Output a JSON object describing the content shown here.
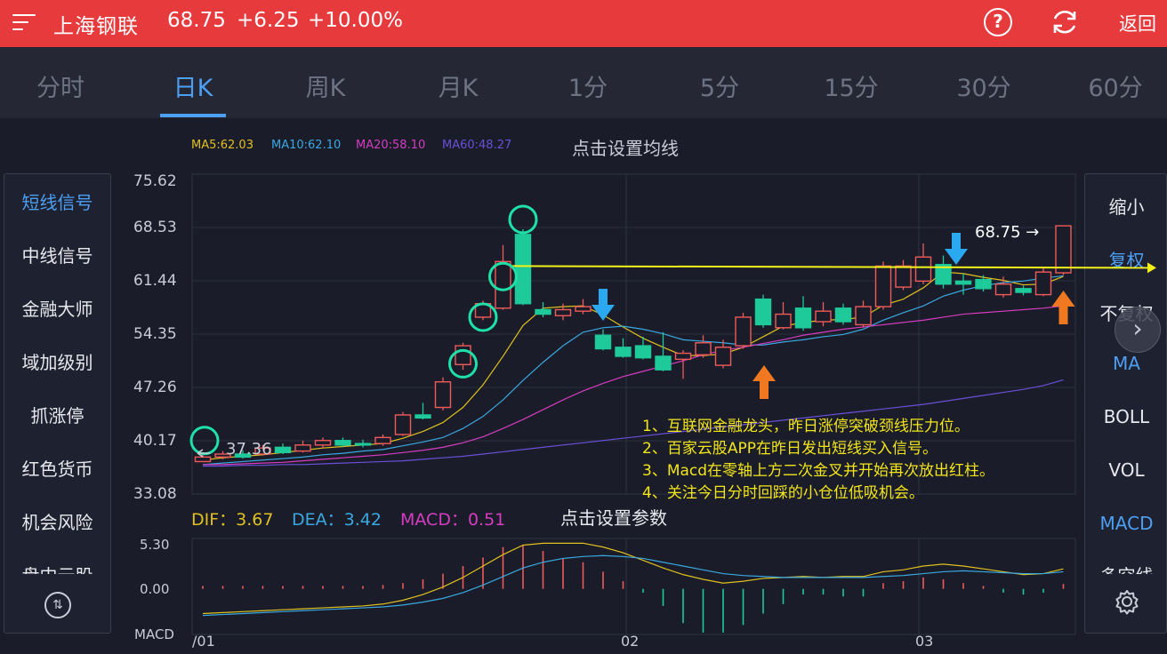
{
  "header": {
    "title": "上海钢联",
    "price": "68.75",
    "change": "+6.25",
    "change_pct": "+10.00%",
    "back_label": "返回",
    "help_label": "?"
  },
  "tabs": [
    {
      "label": "分时",
      "active": false
    },
    {
      "label": "日K",
      "active": true
    },
    {
      "label": "周K",
      "active": false
    },
    {
      "label": "月K",
      "active": false
    },
    {
      "label": "1分",
      "active": false
    },
    {
      "label": "5分",
      "active": false
    },
    {
      "label": "15分",
      "active": false
    },
    {
      "label": "30分",
      "active": false
    },
    {
      "label": "60分",
      "active": false
    }
  ],
  "ma_legend": [
    {
      "label": "MA5:62.03",
      "color": "#e0c020"
    },
    {
      "label": "MA10:62.10",
      "color": "#3aa8e0"
    },
    {
      "label": "MA20:58.10",
      "color": "#d63cc0"
    },
    {
      "label": "MA60:48.27",
      "color": "#6a4fd8"
    }
  ],
  "ma_setting_label": "点击设置均线",
  "left_panel": {
    "items": [
      {
        "label": "短线信号",
        "active": true
      },
      {
        "label": "中线信号",
        "active": false
      },
      {
        "label": "金融大师",
        "active": false
      },
      {
        "label": "域加级别",
        "active": false
      },
      {
        "label": "抓涨停",
        "active": false
      },
      {
        "label": "红色货币",
        "active": false
      },
      {
        "label": "机会风险",
        "active": false
      },
      {
        "label": "盘中云股",
        "active": false
      }
    ]
  },
  "right_panel": {
    "items": [
      {
        "label": "缩小",
        "blue": false
      },
      {
        "label": "复权",
        "blue": true
      },
      {
        "label": "不复权",
        "blue": false
      },
      {
        "label": "MA",
        "blue": true
      },
      {
        "label": "BOLL",
        "blue": false
      },
      {
        "label": "VOL",
        "blue": false
      },
      {
        "label": "MACD",
        "blue": true
      },
      {
        "label": "多空线",
        "blue": false
      }
    ]
  },
  "price_axis": [
    "75.62",
    "68.53",
    "61.44",
    "54.35",
    "47.26",
    "40.17",
    "33.08"
  ],
  "indicator": {
    "dif": "DIF：3.67",
    "dea": "DEA：3.42",
    "macd": "MACD：0.51",
    "dif_color": "#e0c020",
    "dea_color": "#3aa8e0",
    "macd_color": "#d63cc0",
    "setting_label": "点击设置参数"
  },
  "macd_axis": [
    "5.30",
    "0.00",
    "MACD"
  ],
  "date_labels": [
    "/01",
    "02",
    "03"
  ],
  "notes": [
    "1、互联网金融龙头，昨日涨停突破颈线压力位。",
    "2、百家云股APP在昨日发出短线买入信号。",
    "3、Macd在零轴上方二次金叉并开始再次放出红柱。",
    "4、关注今日分时回踩的小仓位低吸机会。"
  ],
  "marks": {
    "last_price": "68.75 →",
    "low_price": "37.36"
  },
  "colors": {
    "up": "#f05a5a",
    "down": "#1ec99a",
    "resistance_line": "#f2f21a",
    "signal_circle": "#1ee0a8",
    "sell_arrow": "#2aa8f0",
    "buy_arrow": "#f07820"
  },
  "chart_data": {
    "type": "candlestick",
    "ylim": [
      33.08,
      75.62
    ],
    "candles": [
      {
        "o": 37.4,
        "c": 38.0,
        "h": 38.3,
        "l": 37.36
      },
      {
        "o": 38.0,
        "c": 38.4,
        "h": 38.8,
        "l": 37.7
      },
      {
        "o": 38.4,
        "c": 38.0,
        "h": 38.9,
        "l": 37.8
      },
      {
        "o": 38.4,
        "c": 39.2,
        "h": 39.6,
        "l": 38.2
      },
      {
        "o": 39.3,
        "c": 38.6,
        "h": 39.8,
        "l": 38.4
      },
      {
        "o": 38.8,
        "c": 39.6,
        "h": 40.2,
        "l": 38.6
      },
      {
        "o": 39.6,
        "c": 40.2,
        "h": 40.6,
        "l": 39.2
      },
      {
        "o": 40.2,
        "c": 39.6,
        "h": 40.6,
        "l": 39.3
      },
      {
        "o": 39.8,
        "c": 39.6,
        "h": 40.3,
        "l": 39.3
      },
      {
        "o": 39.8,
        "c": 40.6,
        "h": 41.0,
        "l": 39.5
      },
      {
        "o": 41.0,
        "c": 43.6,
        "h": 44.0,
        "l": 40.8
      },
      {
        "o": 43.6,
        "c": 43.2,
        "h": 45.2,
        "l": 43.0
      },
      {
        "o": 44.6,
        "c": 48.0,
        "h": 48.6,
        "l": 44.2
      },
      {
        "o": 50.3,
        "c": 52.8,
        "h": 53.2,
        "l": 49.6
      },
      {
        "o": 56.6,
        "c": 58.4,
        "h": 58.8,
        "l": 56.2
      },
      {
        "o": 57.8,
        "c": 64.0,
        "h": 66.2,
        "l": 57.6
      },
      {
        "o": 67.6,
        "c": 58.4,
        "h": 68.3,
        "l": 58.2
      },
      {
        "o": 57.6,
        "c": 57.0,
        "h": 58.6,
        "l": 56.6
      },
      {
        "o": 56.8,
        "c": 57.6,
        "h": 58.4,
        "l": 56.2
      },
      {
        "o": 57.4,
        "c": 58.0,
        "h": 59.0,
        "l": 57.0
      },
      {
        "o": 54.2,
        "c": 52.4,
        "h": 55.0,
        "l": 52.2
      },
      {
        "o": 52.6,
        "c": 51.4,
        "h": 53.8,
        "l": 51.2
      },
      {
        "o": 52.8,
        "c": 51.2,
        "h": 54.0,
        "l": 51.0
      },
      {
        "o": 51.4,
        "c": 49.6,
        "h": 54.6,
        "l": 49.4
      },
      {
        "o": 51.0,
        "c": 51.8,
        "h": 52.2,
        "l": 48.4
      },
      {
        "o": 51.6,
        "c": 53.2,
        "h": 54.2,
        "l": 51.2
      },
      {
        "o": 50.2,
        "c": 52.6,
        "h": 53.6,
        "l": 49.8
      },
      {
        "o": 52.8,
        "c": 56.6,
        "h": 57.2,
        "l": 52.4
      },
      {
        "o": 59.0,
        "c": 55.6,
        "h": 59.6,
        "l": 55.2
      },
      {
        "o": 55.2,
        "c": 57.0,
        "h": 58.6,
        "l": 55.0
      },
      {
        "o": 57.8,
        "c": 55.2,
        "h": 59.4,
        "l": 54.8
      },
      {
        "o": 56.0,
        "c": 57.4,
        "h": 58.6,
        "l": 55.4
      },
      {
        "o": 57.8,
        "c": 56.0,
        "h": 58.4,
        "l": 55.6
      },
      {
        "o": 55.6,
        "c": 58.0,
        "h": 58.8,
        "l": 55.2
      },
      {
        "o": 58.0,
        "c": 63.4,
        "h": 64.0,
        "l": 57.6
      },
      {
        "o": 60.6,
        "c": 63.4,
        "h": 64.2,
        "l": 60.2
      },
      {
        "o": 61.4,
        "c": 64.6,
        "h": 66.4,
        "l": 61.0
      },
      {
        "o": 63.6,
        "c": 61.0,
        "h": 64.8,
        "l": 60.4
      },
      {
        "o": 61.4,
        "c": 61.0,
        "h": 62.4,
        "l": 59.6
      },
      {
        "o": 61.6,
        "c": 60.4,
        "h": 62.2,
        "l": 60.0
      },
      {
        "o": 59.6,
        "c": 61.0,
        "h": 62.0,
        "l": 59.2
      },
      {
        "o": 60.4,
        "c": 59.9,
        "h": 60.8,
        "l": 59.5
      },
      {
        "o": 59.6,
        "c": 62.6,
        "h": 63.2,
        "l": 59.4
      },
      {
        "o": 62.5,
        "c": 68.75,
        "h": 68.75,
        "l": 62.2
      }
    ],
    "ma_series": [
      {
        "name": "MA5",
        "values": [
          37.6,
          37.9,
          38.1,
          38.3,
          38.6,
          38.9,
          39.2,
          39.4,
          39.6,
          39.8,
          40.5,
          41.4,
          42.6,
          44.6,
          47.6,
          51.4,
          55.5,
          57.8,
          58.0,
          58.1,
          56.9,
          55.3,
          53.8,
          52.6,
          51.5,
          51.5,
          51.7,
          52.6,
          54.0,
          55.4,
          55.9,
          56.2,
          56.3,
          56.6,
          58.2,
          59.0,
          60.5,
          62.6,
          62.4,
          61.9,
          61.5,
          60.9,
          61.0,
          62.03
        ]
      },
      {
        "name": "MA10",
        "values": [
          37.0,
          37.2,
          37.4,
          37.6,
          37.8,
          38.0,
          38.3,
          38.5,
          38.8,
          39.0,
          39.5,
          40.0,
          40.6,
          41.8,
          43.4,
          45.6,
          48.2,
          50.6,
          52.8,
          54.6,
          55.2,
          55.4,
          55.0,
          54.4,
          53.6,
          53.4,
          53.2,
          52.9,
          52.9,
          53.3,
          53.6,
          54.0,
          54.3,
          55.0,
          56.2,
          57.2,
          58.1,
          59.4,
          60.2,
          60.8,
          61.2,
          61.4,
          61.8,
          62.1
        ]
      },
      {
        "name": "MA20",
        "values": [
          37.0,
          37.0,
          37.1,
          37.2,
          37.3,
          37.5,
          37.7,
          37.9,
          38.1,
          38.3,
          38.6,
          38.9,
          39.3,
          39.9,
          40.7,
          41.8,
          43.0,
          44.3,
          45.6,
          46.8,
          47.8,
          48.7,
          49.4,
          50.1,
          50.8,
          51.6,
          52.2,
          52.6,
          53.1,
          53.6,
          54.2,
          54.6,
          55.0,
          55.3,
          55.6,
          55.9,
          56.2,
          56.6,
          57.0,
          57.2,
          57.4,
          57.6,
          57.8,
          58.1
        ]
      },
      {
        "name": "MA60",
        "values": [
          36.8,
          36.8,
          36.9,
          36.9,
          37.0,
          37.0,
          37.1,
          37.2,
          37.3,
          37.4,
          37.5,
          37.7,
          37.9,
          38.1,
          38.4,
          38.7,
          39.0,
          39.3,
          39.6,
          39.9,
          40.2,
          40.5,
          40.8,
          41.1,
          41.4,
          41.7,
          42.0,
          42.3,
          42.6,
          42.9,
          43.2,
          43.5,
          43.8,
          44.1,
          44.4,
          44.7,
          45.0,
          45.4,
          45.8,
          46.2,
          46.6,
          47.0,
          47.5,
          48.27
        ]
      }
    ],
    "macd": {
      "ylim": [
        -4.8,
        5.3
      ],
      "dif": [
        -2.6,
        -2.5,
        -2.4,
        -2.3,
        -2.2,
        -2.1,
        -2.0,
        -1.9,
        -1.8,
        -1.6,
        -1.2,
        -0.6,
        0.2,
        1.2,
        2.4,
        3.6,
        4.6,
        4.8,
        4.8,
        4.8,
        4.4,
        3.8,
        3.0,
        2.2,
        1.5,
        1.0,
        0.6,
        0.8,
        1.1,
        1.2,
        1.3,
        1.2,
        1.3,
        1.3,
        1.8,
        2.0,
        2.4,
        2.6,
        2.4,
        2.1,
        1.8,
        1.5,
        1.6,
        2.1
      ],
      "dea": [
        -2.8,
        -2.7,
        -2.6,
        -2.5,
        -2.4,
        -2.3,
        -2.2,
        -2.1,
        -2.0,
        -1.9,
        -1.7,
        -1.4,
        -1.0,
        -0.4,
        0.4,
        1.3,
        2.2,
        2.8,
        3.2,
        3.4,
        3.5,
        3.4,
        3.2,
        2.8,
        2.4,
        2.0,
        1.6,
        1.4,
        1.3,
        1.2,
        1.2,
        1.2,
        1.2,
        1.2,
        1.3,
        1.4,
        1.6,
        1.8,
        1.9,
        1.8,
        1.7,
        1.6,
        1.6,
        1.8
      ],
      "hist": [
        0.3,
        0.3,
        0.3,
        0.3,
        0.3,
        0.3,
        0.3,
        0.3,
        0.3,
        0.4,
        0.6,
        1.0,
        1.6,
        2.4,
        3.3,
        4.4,
        4.6,
        4.0,
        3.2,
        2.8,
        1.8,
        0.8,
        -0.4,
        -1.8,
        -3.6,
        -4.6,
        -4.6,
        -3.8,
        -2.6,
        -1.6,
        -0.6,
        -0.6,
        -0.8,
        -0.8,
        0.6,
        0.8,
        1.2,
        1.0,
        0.6,
        0.3,
        -0.4,
        -0.6,
        -0.4,
        0.51
      ]
    }
  }
}
